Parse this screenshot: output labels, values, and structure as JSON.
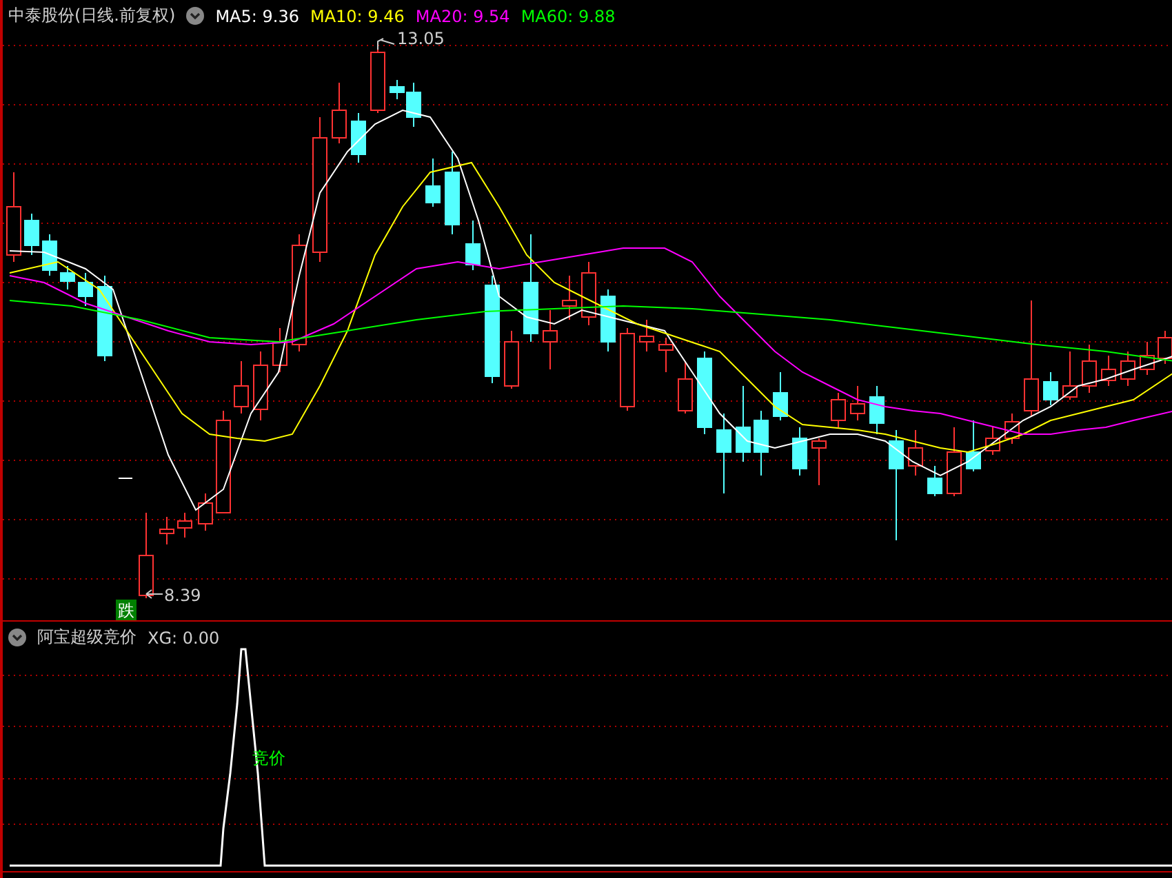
{
  "price_panel": {
    "title": "中泰股份(日线.前复权)",
    "indicators": [
      {
        "label": "MA5: 9.36",
        "color": "#ffffff"
      },
      {
        "label": "MA10: 9.46",
        "color": "#ffff00"
      },
      {
        "label": "MA20: 9.54",
        "color": "#ff00ff"
      },
      {
        "label": "MA60: 9.88",
        "color": "#00ff00"
      }
    ],
    "annotations": [
      {
        "kind": "high",
        "text": "13.05"
      },
      {
        "kind": "low",
        "text": "8.39"
      }
    ],
    "signal": "跌"
  },
  "indicator_panel": {
    "title": "阿宝超级竞价",
    "reading": "XG: 0.00",
    "signal_label": "竞价"
  }
}
